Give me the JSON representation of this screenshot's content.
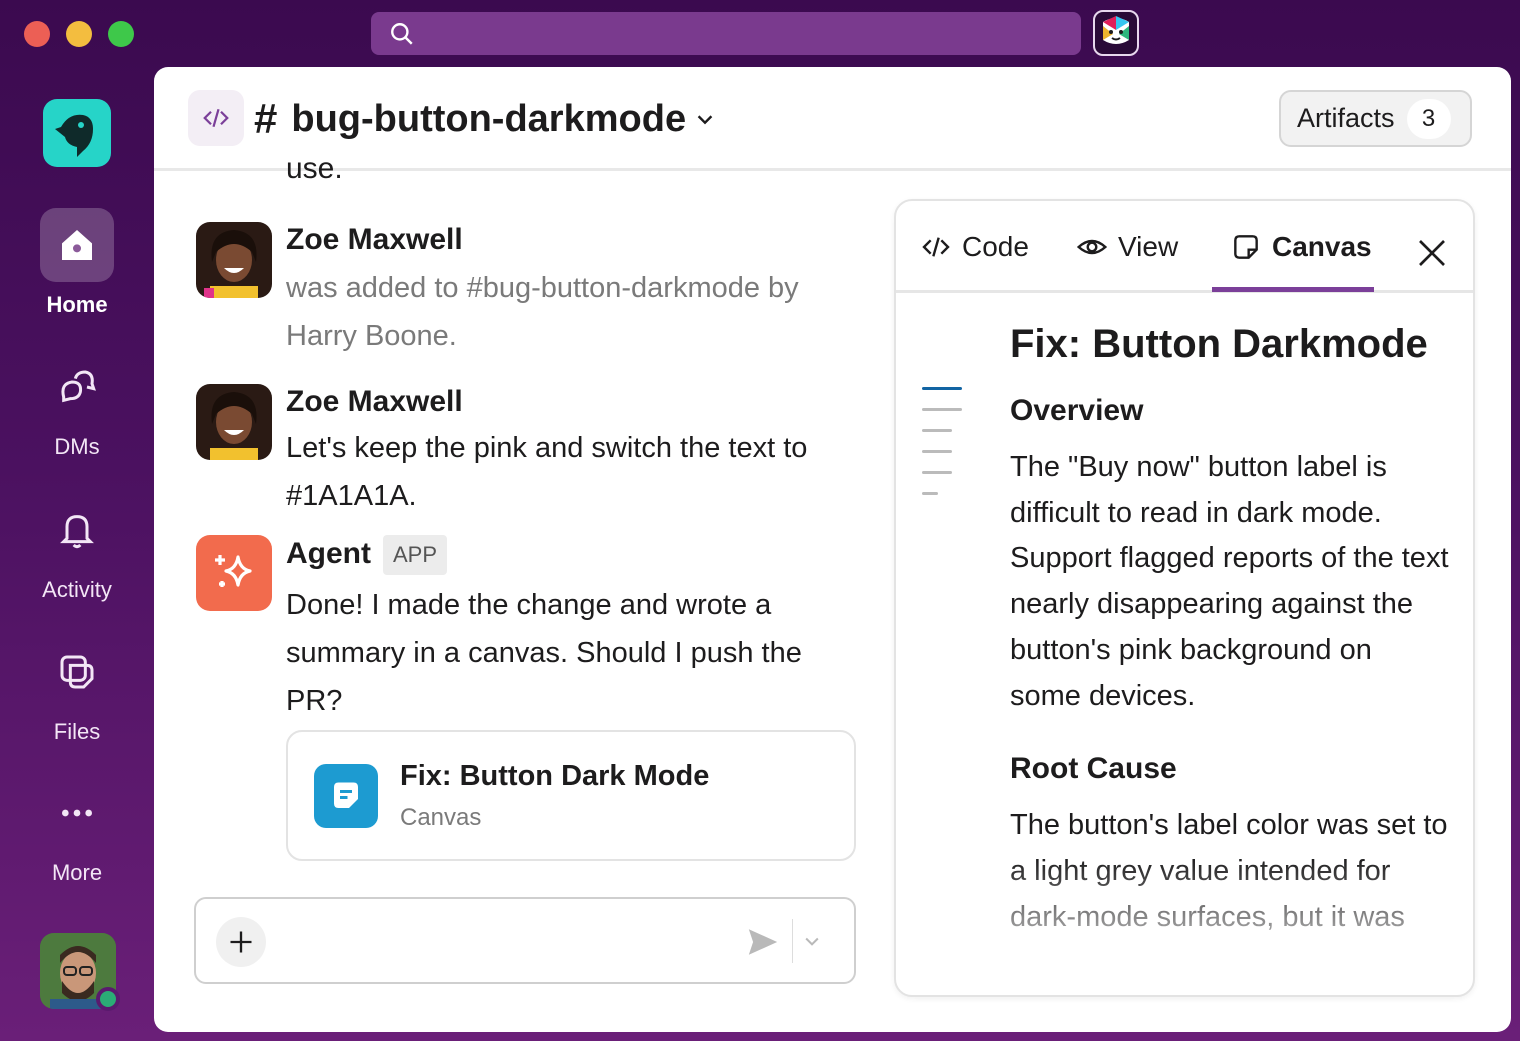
{
  "window": {
    "search_placeholder": ""
  },
  "sidebar": {
    "items": [
      {
        "label": "Home",
        "icon": "home-icon",
        "active": true
      },
      {
        "label": "DMs",
        "icon": "dms-icon"
      },
      {
        "label": "Activity",
        "icon": "bell-icon"
      },
      {
        "label": "Files",
        "icon": "files-icon"
      },
      {
        "label": "More",
        "icon": "more-icon"
      }
    ]
  },
  "channel": {
    "name": "bug-button-darkmode",
    "hash": "#",
    "artifacts_label": "Artifacts",
    "artifacts_count": "3"
  },
  "messages": {
    "cut_text": "use.",
    "m1": {
      "author": "Zoe Maxwell",
      "text": "was added to #bug-button-darkmode by Harry Boone."
    },
    "m2": {
      "author": "Zoe Maxwell",
      "text": "Let's keep the pink and switch the text to #1A1A1A."
    },
    "m3": {
      "author": "Agent",
      "badge": "APP",
      "text": "Done! I made the change and wrote a summary in a canvas. Should I push the PR?"
    },
    "file": {
      "title": "Fix: Button Dark Mode",
      "type": "Canvas"
    }
  },
  "composer": {
    "placeholder": ""
  },
  "panel": {
    "tabs": [
      {
        "label": "Code",
        "icon": "code-icon"
      },
      {
        "label": "View",
        "icon": "eye-icon"
      },
      {
        "label": "Canvas",
        "icon": "canvas-icon",
        "active": true
      }
    ],
    "doc": {
      "title": "Fix: Button Darkmode",
      "h_overview": "Overview",
      "p_overview": "The \"Buy now\" button label is difficult to read in dark mode. Support flagged reports of the text nearly disappearing against the button's pink background on some devices.",
      "h_root": "Root Cause",
      "p_root": "The button's label color was set to a light grey value intended for dark-mode surfaces, but it was"
    }
  },
  "colors": {
    "accent": "#7b3f99",
    "brand_teal": "#26d4c8",
    "agent_orange": "#f26b4d",
    "canvas_blue": "#1d9bd1"
  }
}
